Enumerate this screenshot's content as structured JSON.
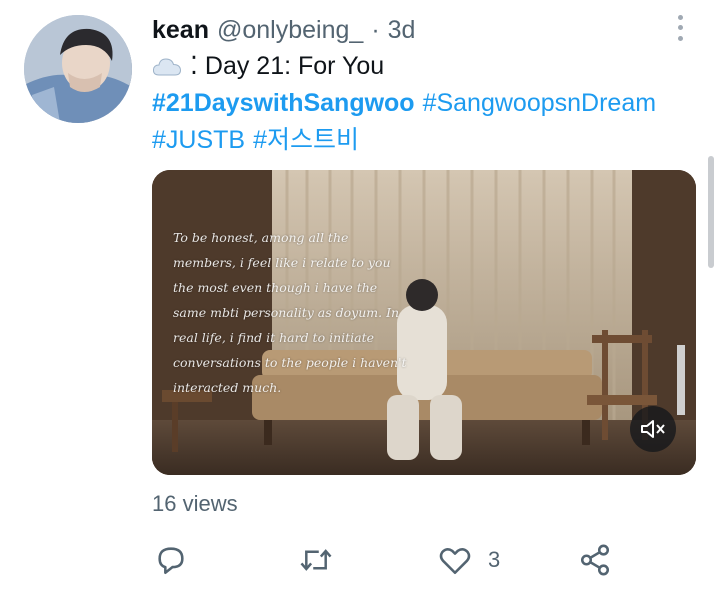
{
  "tweet": {
    "display_name": "kean",
    "handle": "@onlybeing_",
    "separator": "·",
    "time": "3d",
    "line1_prefix": "☁️",
    "line1_text": "⁚ Day 21: For You",
    "hashtags": [
      "#21DayswithSangwoo",
      "#SangwoopsnDream",
      "#JUSTB",
      "#저스트비"
    ],
    "video_caption": "To be honest, among all the members, i feel like i relate to you the most even though i have the same mbti personality as doyum. In real life, i find it hard to initiate conversations to the people i haven't interacted much.",
    "views": "16 views",
    "like_count": "3"
  },
  "colors": {
    "link": "#1d9bf0",
    "text": "#0f1419",
    "muted": "#536471"
  },
  "icons": [
    "more-icon",
    "reply-icon",
    "retweet-icon",
    "like-icon",
    "share-icon",
    "mute-icon",
    "cloud-icon"
  ]
}
